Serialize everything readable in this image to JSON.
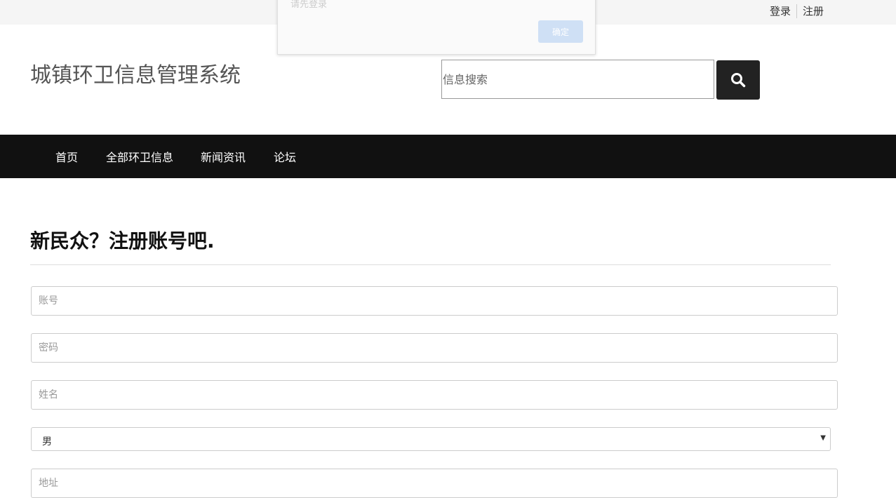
{
  "topbar": {
    "login": "登录",
    "register": "注册"
  },
  "header": {
    "site_title": "城镇环卫信息管理系统",
    "search_placeholder": "信息搜索",
    "search_icon": "search-icon"
  },
  "nav": {
    "items": [
      "首页",
      "全部环卫信息",
      "新闻资讯",
      "论坛"
    ]
  },
  "form": {
    "title": "新民众？注册账号吧.",
    "account_placeholder": "账号",
    "password_placeholder": "密码",
    "name_placeholder": "姓名",
    "gender_value": "男",
    "gender_arrow": "▼",
    "next_placeholder": "地址"
  },
  "dialog": {
    "message": "请先登录",
    "confirm": "确定"
  },
  "colors": {
    "navbar": "#111111",
    "search_button": "#222222",
    "dialog_button": "#cfe0f5"
  }
}
